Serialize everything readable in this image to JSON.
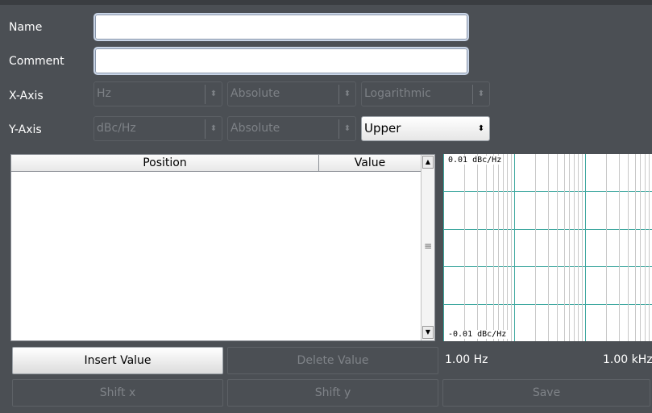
{
  "form": {
    "name_label": "Name",
    "name_value": "",
    "comment_label": "Comment",
    "comment_value": "",
    "xaxis_label": "X-Axis",
    "yaxis_label": "Y-Axis",
    "xaxis": {
      "unit": "Hz",
      "scaling": "Absolute",
      "spacing": "Logarithmic"
    },
    "yaxis": {
      "unit": "dBc/Hz",
      "scaling": "Absolute",
      "limit": "Upper"
    }
  },
  "table": {
    "col_position": "Position",
    "col_value": "Value",
    "rows": []
  },
  "graph": {
    "y_max_label": "0.01 dBc/Hz",
    "y_min_label": "-0.01 dBc/Hz",
    "x_start_label": "1.00 Hz",
    "x_end_label": "1.00 kHz",
    "grid_color": "#3fa8a0"
  },
  "buttons": {
    "insert_value": "Insert Value",
    "delete_value": "Delete Value",
    "shift_x": "Shift x",
    "shift_y": "Shift y",
    "save": "Save"
  },
  "icons": {
    "dropdown": "updown-arrows-icon",
    "scroll_up": "triangle-up-icon",
    "scroll_down": "triangle-down-icon"
  }
}
